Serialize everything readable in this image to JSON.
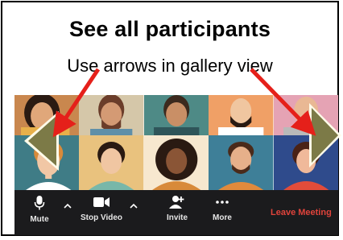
{
  "heading": {
    "title": "See all participants",
    "subtitle": "Use arrows in gallery view"
  },
  "toolbar": {
    "mute_label": "Mute",
    "stop_video_label": "Stop Video",
    "invite_label": "Invite",
    "more_label": "More",
    "leave_label": "Leave Meeting"
  },
  "colors": {
    "toolbar_bg": "#1b1b1d",
    "leave_red": "#e0433b",
    "annotation_red": "#e5201a",
    "arrow_olive": "#7c7a47"
  }
}
